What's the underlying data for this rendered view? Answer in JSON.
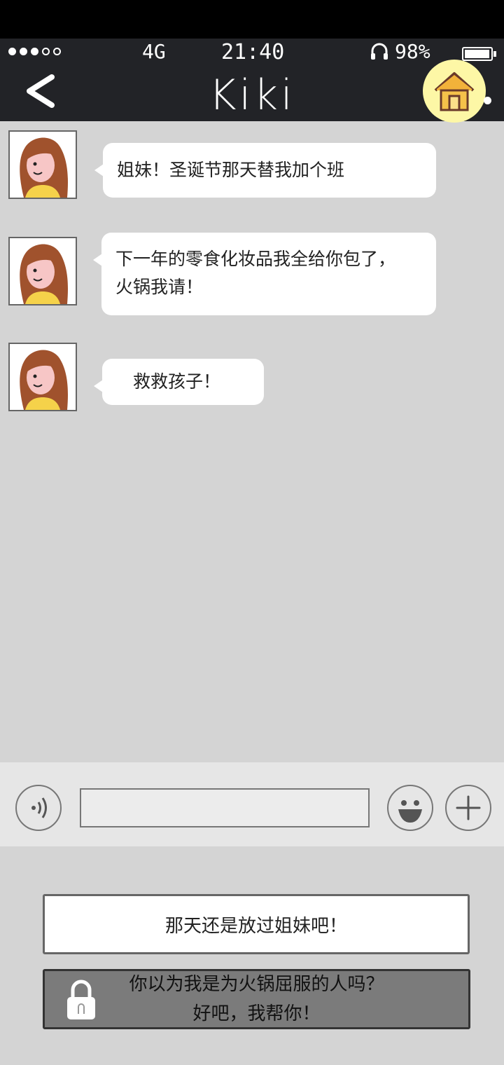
{
  "status_bar": {
    "network": "4G",
    "time": "21:40",
    "battery_text": "98%",
    "battery_level": 0.98,
    "signal_filled": 3,
    "signal_total": 5
  },
  "header": {
    "back_icon": "chevron-left-icon",
    "title": "Kiki",
    "home_icon": "house-icon"
  },
  "messages": [
    {
      "lines": [
        "姐妹！圣诞节那天替我加个班"
      ]
    },
    {
      "lines": [
        "下一年的零食化妆品我全给你包了，",
        "火锅我请！"
      ]
    },
    {
      "lines": [
        "救救孩子！"
      ]
    }
  ],
  "input_bar": {
    "voice_icon": "voice-icon",
    "text_value": "",
    "emoji_icon": "smiley-icon",
    "plus_icon": "plus-icon"
  },
  "choices": [
    {
      "text": "那天还是放过姐妹吧！",
      "locked": false
    },
    {
      "lines": [
        "你以为我是为火锅屈服的人吗？",
        "好吧，我帮你！"
      ],
      "locked": true,
      "lock_icon": "lock-icon"
    }
  ],
  "colors": {
    "header_bg": "#222327",
    "home_bg": "#fdf7a6",
    "chat_bg": "#d4d4d4",
    "locked_choice_bg": "#7b7b7b"
  }
}
